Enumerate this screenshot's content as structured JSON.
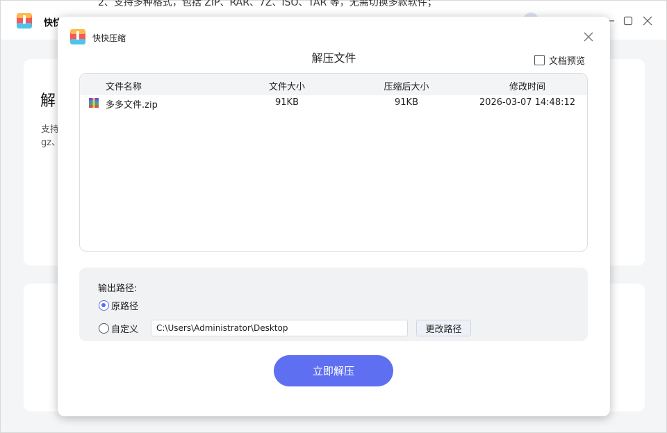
{
  "background": {
    "app_title": "快快",
    "header_text": "2、支持多种格式，包括 ZIP、RAR、7Z、ISO、TAR 等，无需切换多款软件；",
    "card_title": "解",
    "card_desc_line1": "支持",
    "card_desc_line2": "gz、"
  },
  "dialog": {
    "app_name": "快快压缩",
    "heading": "解压文件",
    "preview_label": "文档预览",
    "preview_checked": false,
    "table": {
      "headers": [
        "文件名称",
        "文件大小",
        "压缩后大小",
        "修改时间"
      ],
      "rows": [
        {
          "name": "多多文件.zip",
          "size": "91KB",
          "compressed_size": "91KB",
          "modified": "2026-03-07 14:48:12",
          "icon": "winrar-archive-icon"
        }
      ]
    },
    "output": {
      "label": "输出路径:",
      "option_original": "原路径",
      "option_custom": "自定义",
      "selected": "原路径",
      "custom_path": "C:\\Users\\Administrator\\Desktop",
      "change_button": "更改路径"
    },
    "extract_button": "立即解压"
  },
  "colors": {
    "accent": "#5f6ff1",
    "radio_selected": "#5a6cf0",
    "table_header_bg": "#f3f4f6",
    "panel_bg": "#f1f2f4"
  }
}
